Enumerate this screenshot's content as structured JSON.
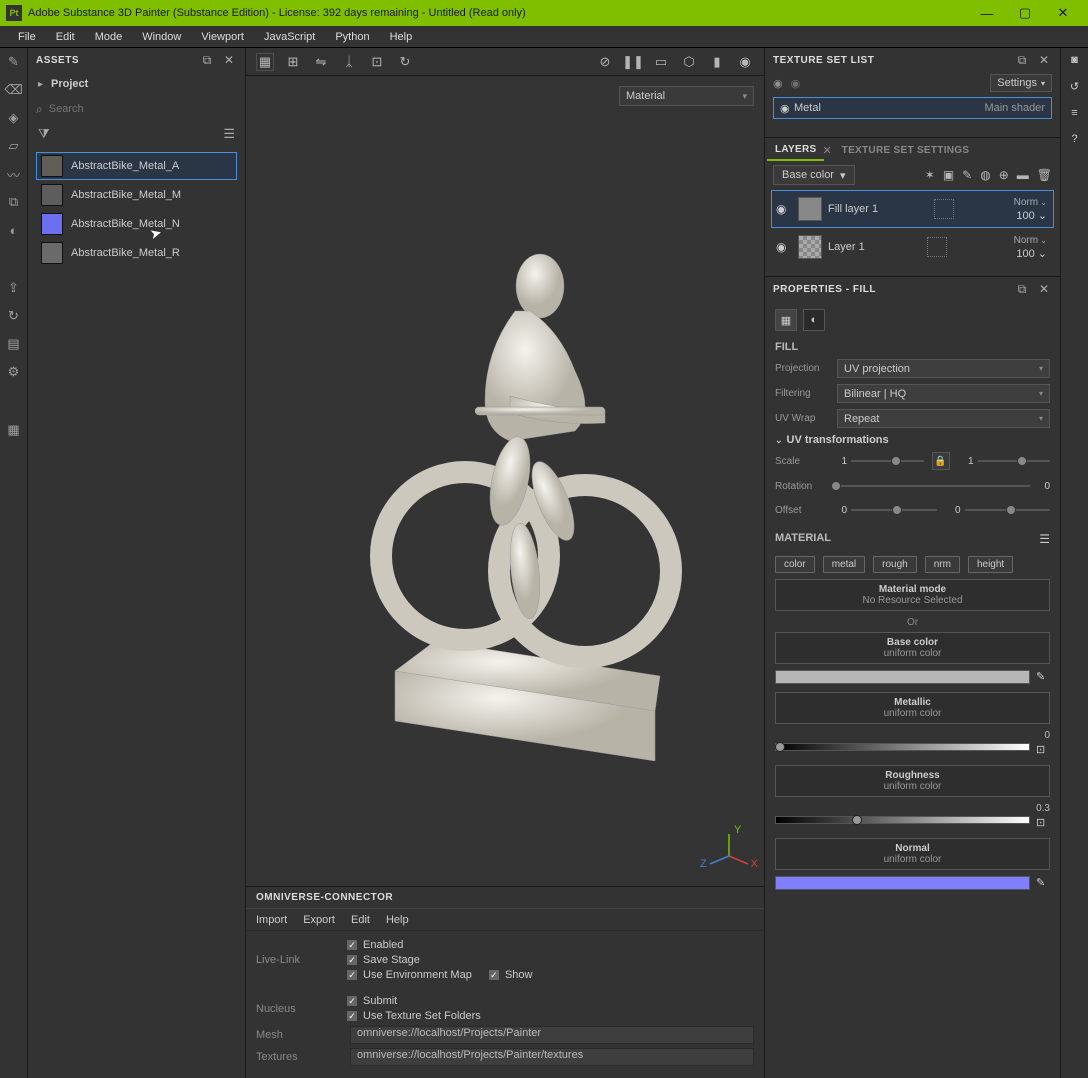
{
  "title": "Adobe Substance 3D Painter (Substance Edition) - License: 392 days remaining - Untitled (Read only)",
  "menubar": [
    "File",
    "Edit",
    "Mode",
    "Window",
    "Viewport",
    "JavaScript",
    "Python",
    "Help"
  ],
  "assets": {
    "title": "ASSETS",
    "breadcrumb": "Project",
    "search_placeholder": "Search",
    "items": [
      {
        "name": "AbstractBike_Metal_A",
        "color": "#615e58",
        "selected": true
      },
      {
        "name": "AbstractBike_Metal_M",
        "color": "#5d5d5d",
        "selected": false
      },
      {
        "name": "AbstractBike_Metal_N",
        "color": "#6e6ef0",
        "selected": false
      },
      {
        "name": "AbstractBike_Metal_R",
        "color": "#6a6a6a",
        "selected": false
      }
    ]
  },
  "viewport": {
    "material_dd": "Material",
    "axis": {
      "x": "X",
      "y": "Y",
      "z": "Z"
    }
  },
  "omni": {
    "title": "OMNIVERSE-CONNECTOR",
    "menu": [
      "Import",
      "Export",
      "Edit",
      "Help"
    ],
    "livelink_label": "Live-Link",
    "nucleus_label": "Nucleus",
    "checks": {
      "enabled": "Enabled",
      "save_stage": "Save Stage",
      "use_env": "Use Environment Map",
      "show": "Show",
      "submit": "Submit",
      "use_tex_folders": "Use Texture Set Folders"
    },
    "mesh_label": "Mesh",
    "mesh_val": "omniverse://localhost/Projects/Painter",
    "tex_label": "Textures",
    "tex_val": "omniverse://localhost/Projects/Painter/textures"
  },
  "tex_set": {
    "title": "TEXTURE SET LIST",
    "settings": "Settings",
    "item": "Metal",
    "shader": "Main shader"
  },
  "layers": {
    "tab_layers": "LAYERS",
    "tab_settings": "TEXTURE SET SETTINGS",
    "channel": "Base color",
    "items": [
      {
        "name": "Fill layer 1",
        "blend": "Norm",
        "opacity": "100",
        "selected": true,
        "fill": true
      },
      {
        "name": "Layer 1",
        "blend": "Norm",
        "opacity": "100",
        "selected": false,
        "fill": false
      }
    ]
  },
  "props": {
    "title": "PROPERTIES - FILL",
    "fill_title": "FILL",
    "projection_label": "Projection",
    "projection": "UV projection",
    "filtering_label": "Filtering",
    "filtering": "Bilinear | HQ",
    "wrap_label": "UV Wrap",
    "wrap": "Repeat",
    "uv_trans": "UV transformations",
    "scale_label": "Scale",
    "scale_a": "1",
    "scale_b": "1",
    "rotation_label": "Rotation",
    "rotation": "0",
    "offset_label": "Offset",
    "offset_a": "0",
    "offset_b": "0",
    "material_title": "MATERIAL",
    "chips": [
      "color",
      "metal",
      "rough",
      "nrm",
      "height"
    ],
    "material_mode": "Material mode",
    "no_resource": "No Resource Selected",
    "or": "Or",
    "base_color": "Base color",
    "uniform": "uniform color",
    "metallic": "Metallic",
    "metallic_val": "0",
    "roughness": "Roughness",
    "roughness_val": "0.3",
    "normal": "Normal"
  }
}
